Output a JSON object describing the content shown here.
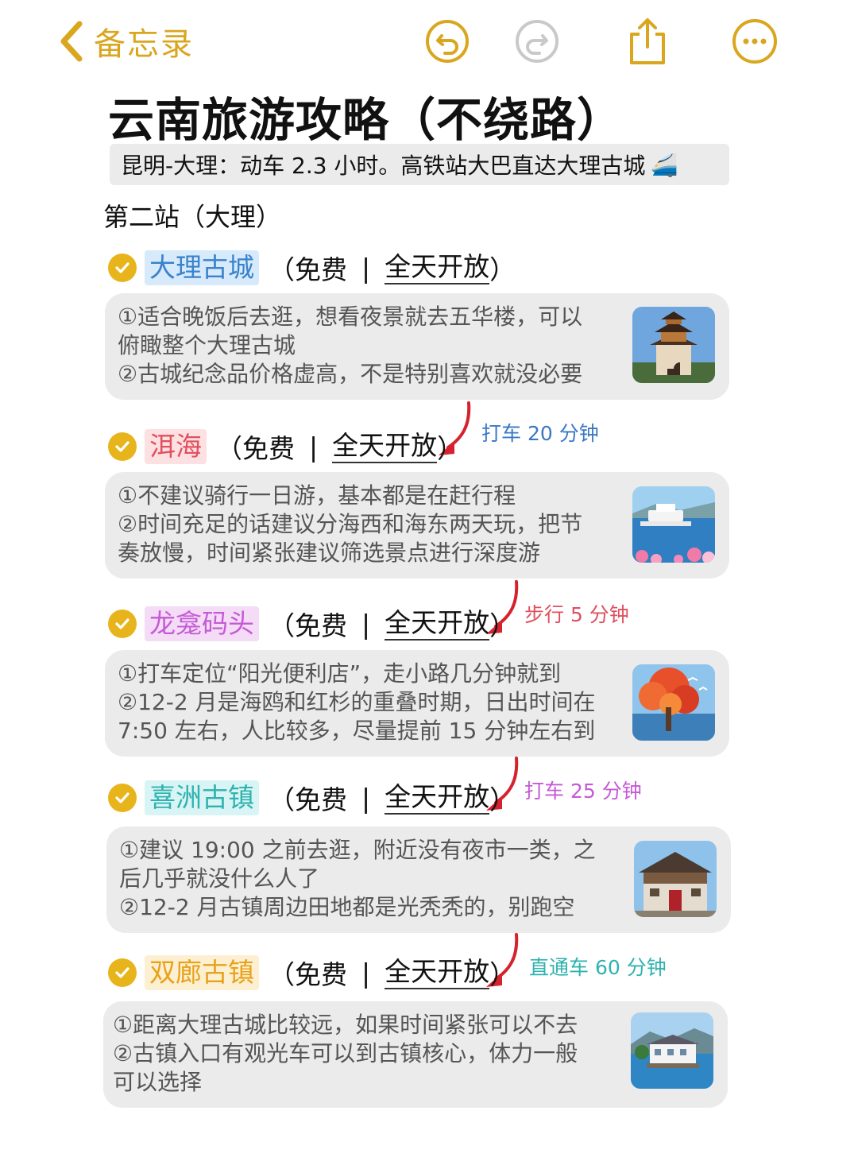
{
  "nav": {
    "back_label": "备忘录",
    "accent": "#d9a61e"
  },
  "toolbar": {
    "undo_icon": "undo-icon",
    "redo_icon": "redo-icon",
    "share_icon": "share-icon",
    "more_icon": "more-icon"
  },
  "note": {
    "title": "云南旅游攻略（不绕路）",
    "subtitle": "昆明-大理：动车 2.3 小时。高铁站大巴直达大理古城",
    "subtitle_emoji": "🚄",
    "section": "第二站（大理）"
  },
  "common": {
    "open_paren": "（免费",
    "sep": "|",
    "hours": "全天开放",
    "close_paren": "）"
  },
  "spots": [
    {
      "name": "大理古城",
      "chip_color": "#d6eafc",
      "name_color": "#3a82c9",
      "lines": [
        "①适合晚饭后去逛，想看夜景就去五华楼，可以",
        "俯瞰整个大理古城",
        "②古城纪念品价格虚高，不是特别喜欢就没必要"
      ],
      "photo": "五华楼-photo"
    },
    {
      "name": "洱海",
      "chip_color": "#fde0e2",
      "name_color": "#e0505e",
      "lines": [
        "①不建议骑行一日游，基本都是在赶行程",
        "②时间充足的话建议分海西和海东两天玩，把节",
        "奏放慢，时间紧张建议筛选景点进行深度游"
      ],
      "photo": "洱海-photo"
    },
    {
      "name": "龙龛码头",
      "chip_color": "#f4dcf6",
      "name_color": "#c55ad6",
      "lines": [
        "①打车定位“阳光便利店”，走小路几分钟就到",
        "②12-2 月是海鸥和红杉的重叠时期，日出时间在",
        "7:50 左右，人比较多，尽量提前 15 分钟左右到"
      ],
      "photo": "红杉-photo"
    },
    {
      "name": "喜洲古镇",
      "chip_color": "#d8f4f4",
      "name_color": "#2fb3b0",
      "lines": [
        "①建议 19:00 之前去逛，附近没有夜市一类，之",
        "后几乎就没什么人了",
        "②12-2 月古镇周边田地都是光秃秃的，别跑空"
      ],
      "photo": "喜洲-photo"
    },
    {
      "name": "双廊古镇",
      "chip_color": "#fdf0d2",
      "name_color": "#e8a21a",
      "lines": [
        "①距离大理古城比较远，如果时间紧张可以不去",
        "②古镇入口有观光车可以到古镇核心，体力一般",
        "可以选择"
      ],
      "photo": "双廊-photo"
    }
  ],
  "transits": [
    {
      "label": "打车 20 分钟",
      "color": "#3a78c4"
    },
    {
      "label": "步行 5 分钟",
      "color": "#e0505e"
    },
    {
      "label": "打车 25 分钟",
      "color": "#c55ad6"
    },
    {
      "label": "直通车 60 分钟",
      "color": "#2fb3b0"
    }
  ]
}
